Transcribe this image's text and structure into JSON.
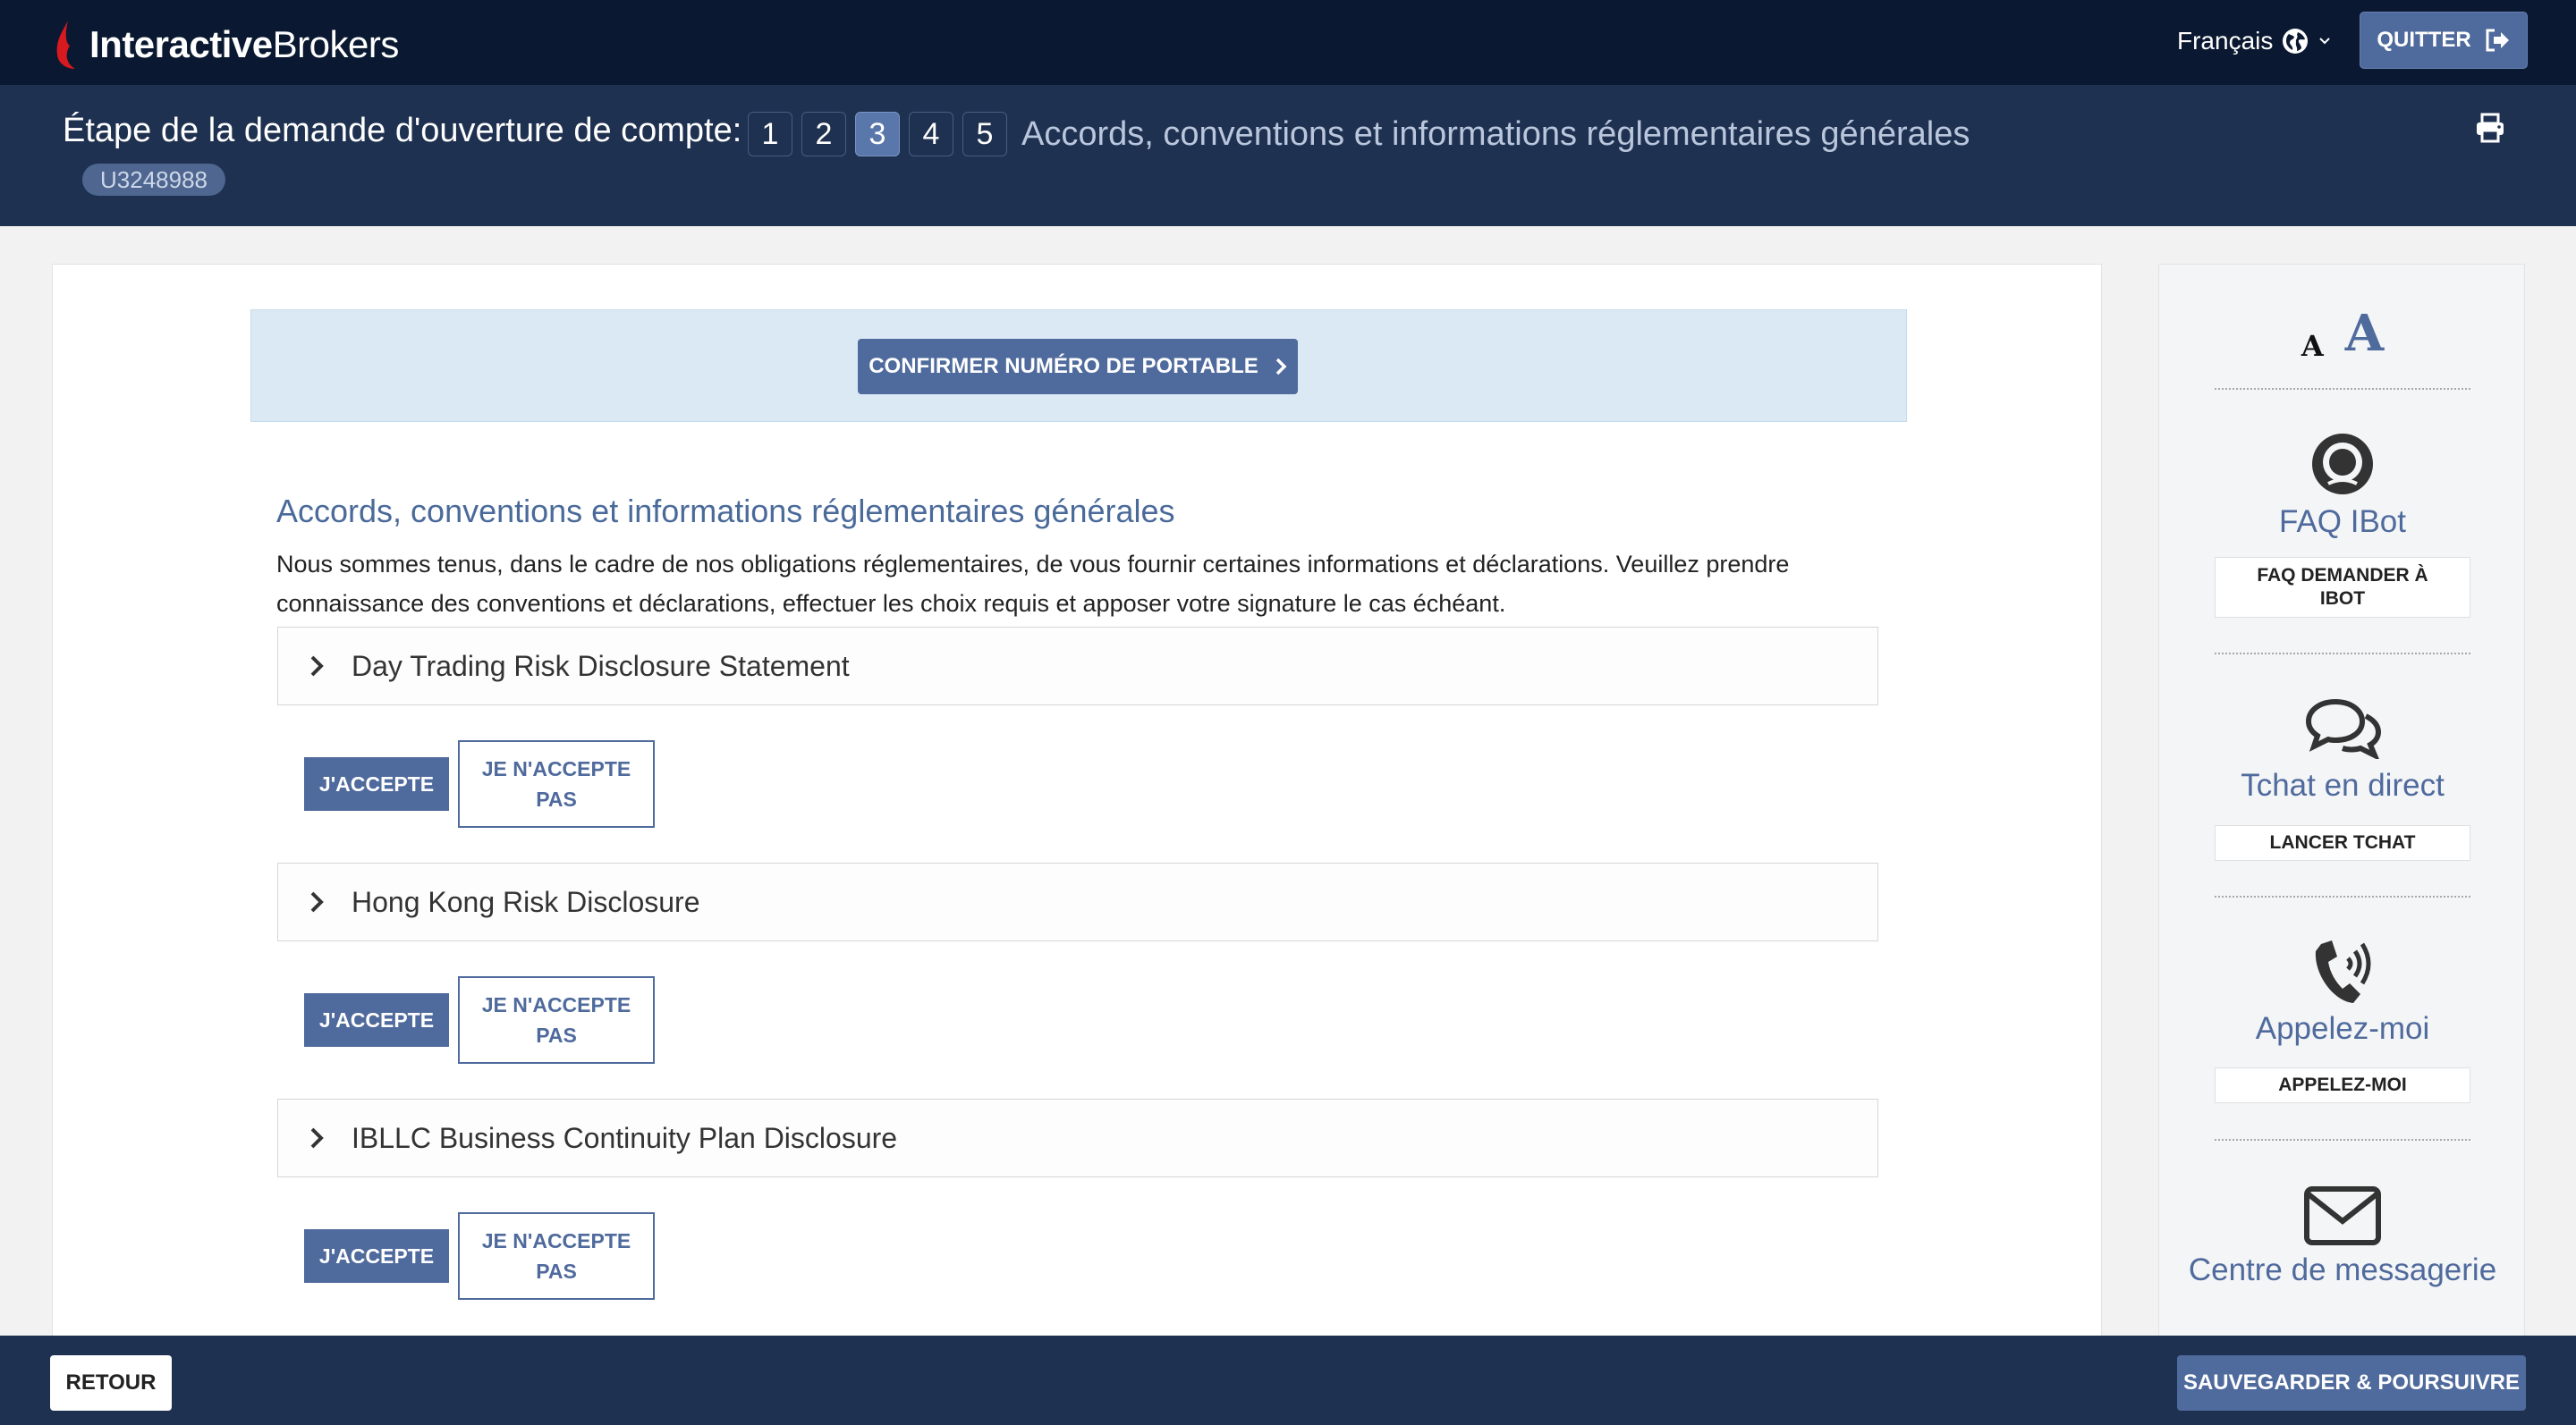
{
  "header": {
    "logo_bold": "Interactive",
    "logo_regular": "Brokers",
    "language": "Français",
    "quit_label": "QUITTER"
  },
  "stepbar": {
    "title": "Étape de la demande d'ouverture de compte:",
    "steps": [
      "1",
      "2",
      "3",
      "4",
      "5"
    ],
    "active_step": "3",
    "step_name": "Accords, conventions et informations réglementaires générales",
    "account_id": "U3248988"
  },
  "main": {
    "confirm_label": "CONFIRMER NUMÉRO DE PORTABLE",
    "section_title": "Accords, conventions et informations réglementaires générales",
    "section_text": "Nous sommes tenus, dans le cadre de nos obligations réglementaires, de vous fournir certaines informations et déclarations. Veuillez prendre connaissance des conventions et déclarations, effectuer les choix requis et apposer votre signature le cas échéant.",
    "disclosures": [
      {
        "title": "Day Trading Risk Disclosure Statement",
        "accept": "J'ACCEPTE",
        "decline": "JE N'ACCEPTE PAS"
      },
      {
        "title": "Hong Kong Risk Disclosure",
        "accept": "J'ACCEPTE",
        "decline": "JE N'ACCEPTE PAS"
      },
      {
        "title": "IBLLC Business Continuity Plan Disclosure",
        "accept": "J'ACCEPTE",
        "decline": "JE N'ACCEPTE PAS"
      }
    ]
  },
  "sidebar": {
    "font_small": "A",
    "font_large": "A",
    "faq_label": "FAQ IBot",
    "faq_button": "FAQ DEMANDER À IBOT",
    "chat_label": "Tchat en direct",
    "chat_button": "LANCER TCHAT",
    "call_label": "Appelez-moi",
    "call_button": "APPELEZ-MOI",
    "message_label": "Centre de messagerie"
  },
  "footer": {
    "back_label": "RETOUR",
    "save_label": "SAUVEGARDER & POURSUIVRE"
  },
  "colors": {
    "topbar": "#0a1931",
    "stepbar": "#1f3151",
    "accent": "#4f6a9c",
    "confirm_band": "#dbe9f4",
    "logo_red": "#d71920"
  },
  "icons": {
    "logo": "ib-flame-icon",
    "language": "globe-icon",
    "quit": "logout-icon",
    "print": "print-icon",
    "faq": "ibot-icon",
    "chat": "chat-bubbles-icon",
    "call": "phone-icon",
    "message": "envelope-icon"
  }
}
